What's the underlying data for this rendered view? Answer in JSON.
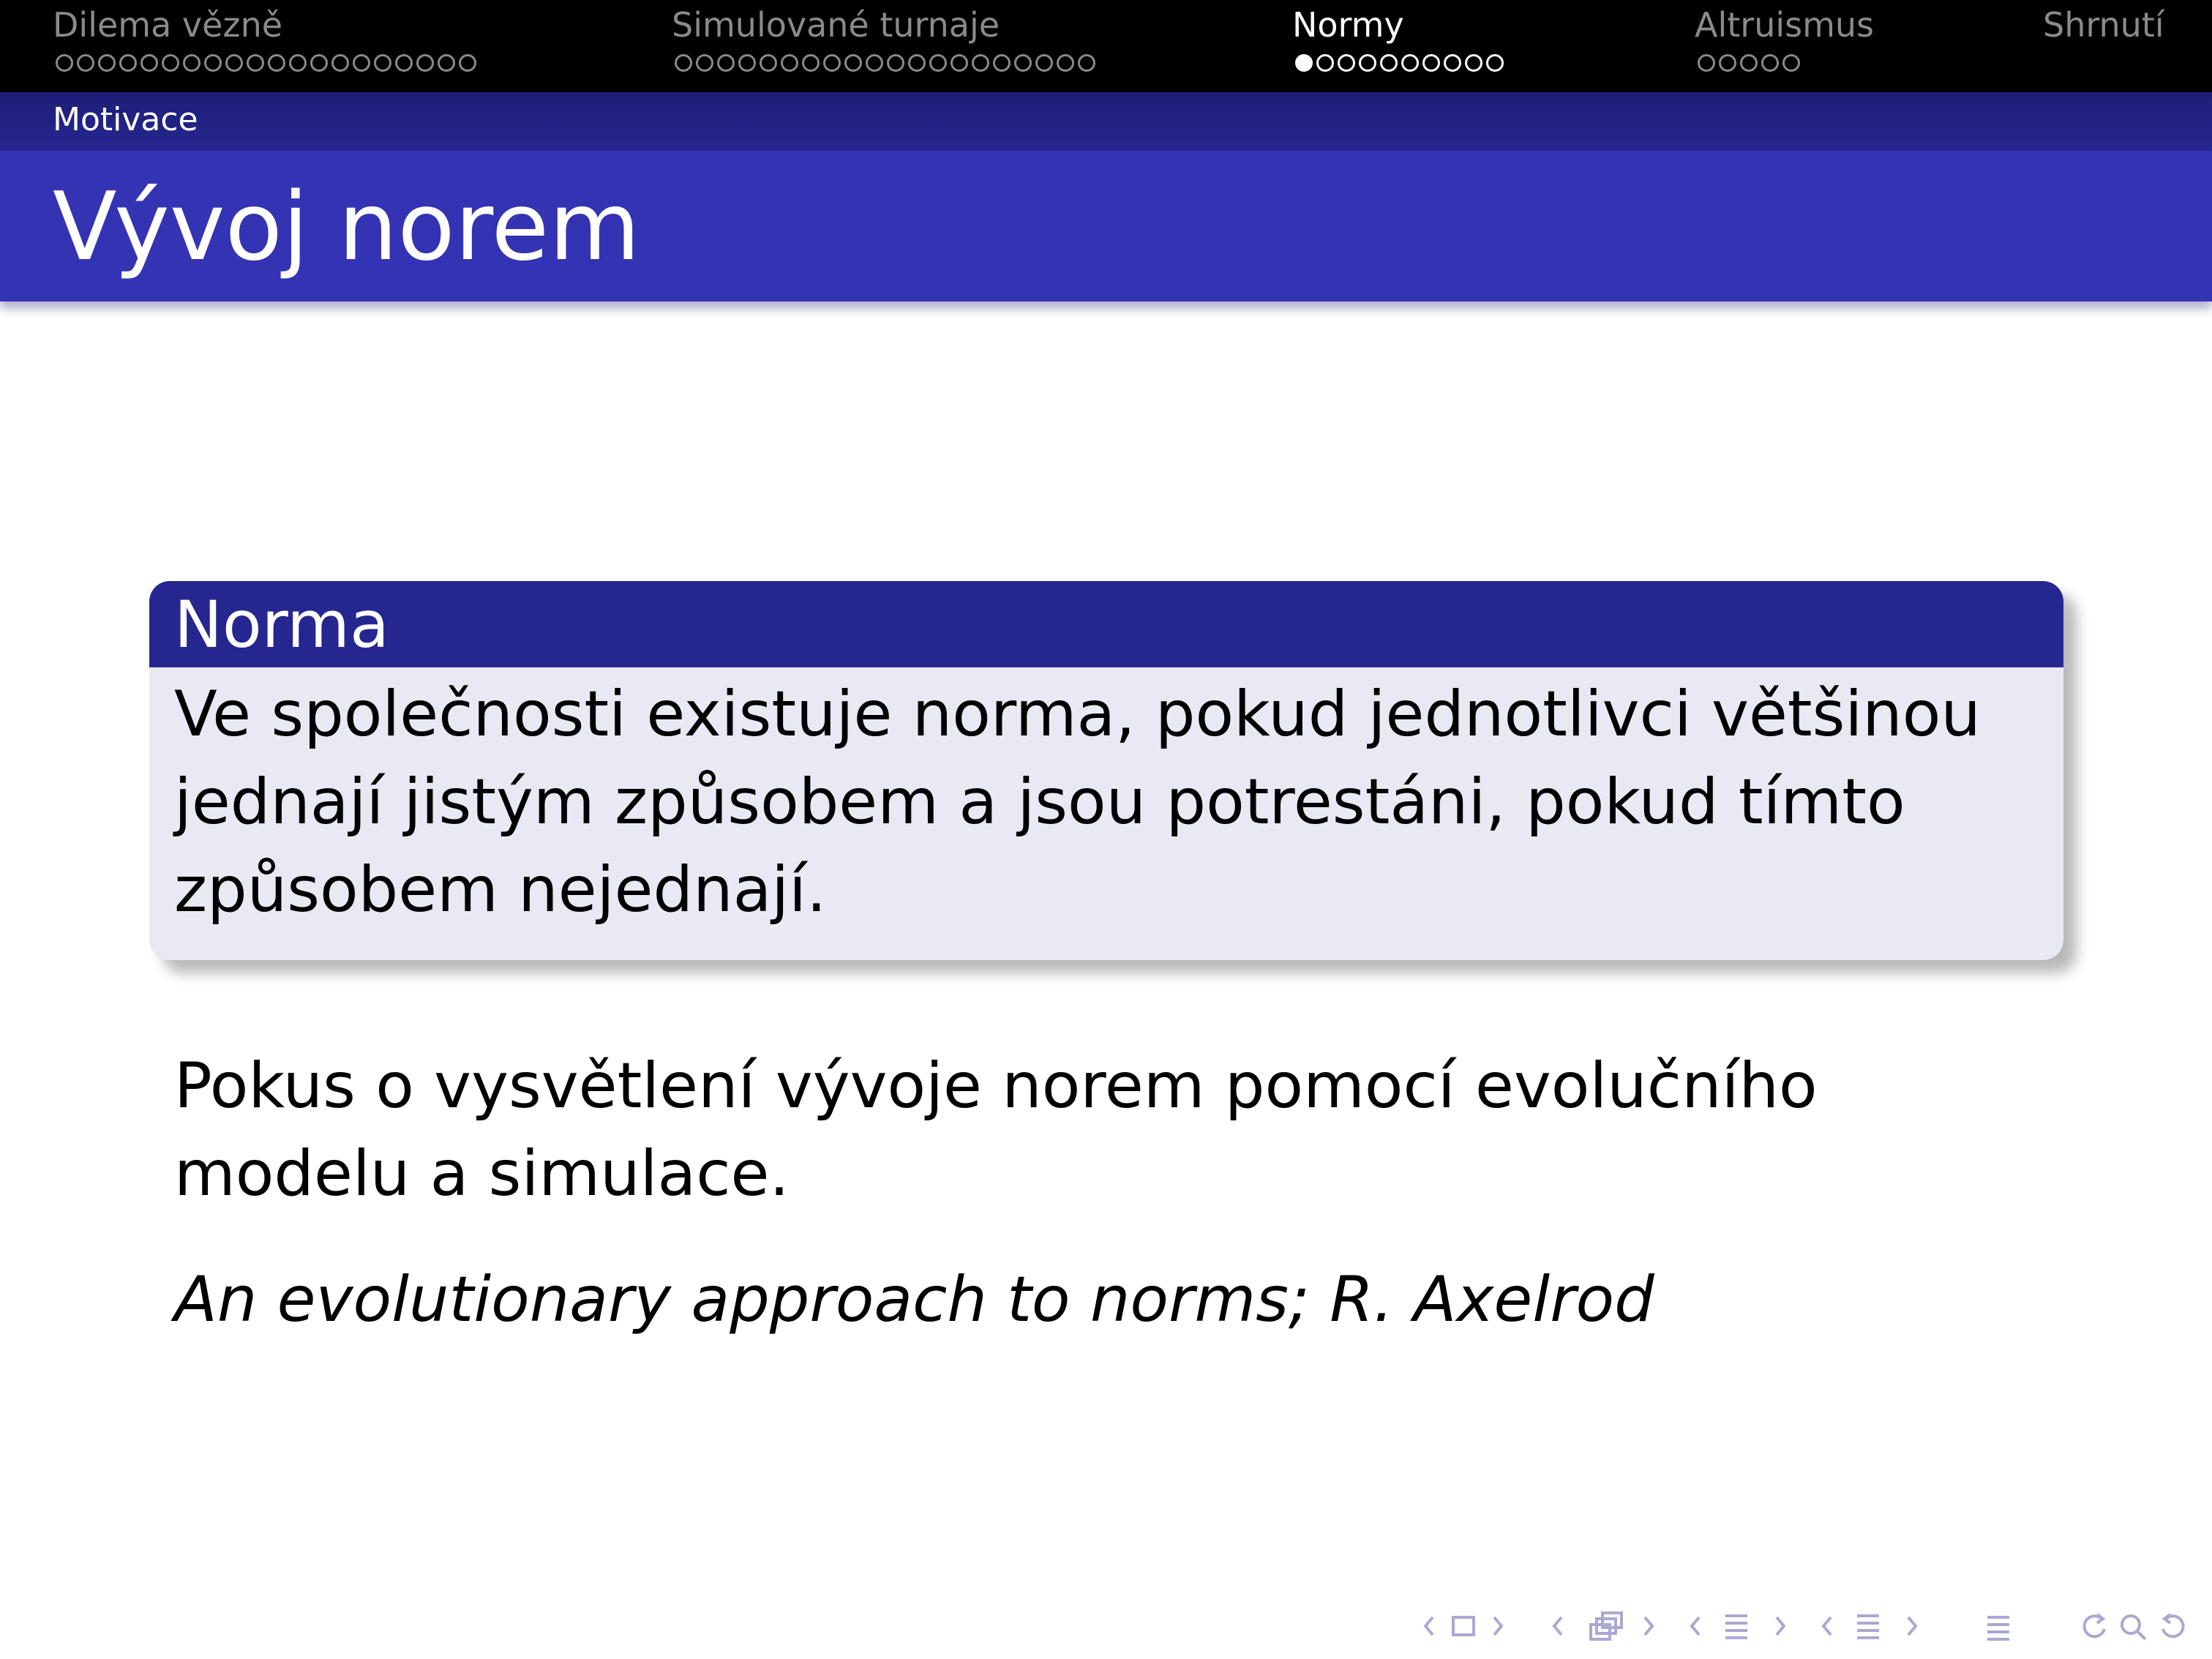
{
  "navigation": {
    "sections": [
      {
        "label": "Dilema vězně",
        "dots": 20,
        "active": false,
        "current_dot": -1
      },
      {
        "label": "Simulované turnaje",
        "dots": 20,
        "active": false,
        "current_dot": -1
      },
      {
        "label": "Normy",
        "dots": 10,
        "active": true,
        "current_dot": 0
      },
      {
        "label": "Altruismus",
        "dots": 5,
        "active": false,
        "current_dot": -1
      },
      {
        "label": "Shrnutí",
        "dots": 0,
        "active": false,
        "current_dot": -1
      }
    ]
  },
  "subsection": "Motivace",
  "frame_title": "Vývoj norem",
  "definition_block": {
    "title": "Norma",
    "body": "Ve společnosti existuje norma, pokud jednotlivci většinou jednají jistým způsobem a jsou potrestáni, pokud tímto způsobem nejednají."
  },
  "paragraph": "Pokus o vysvětlení vývoje norem pomocí evolučního modelu a simulace.",
  "citation": "An evolutionary approach to norms; R. Axelrod",
  "nav_symbols": [
    "frame-nav-icon",
    "subsection-nav-icon",
    "section-nav-icon",
    "presentation-nav-icon",
    "appendix-icon",
    "search-zoom-icon"
  ],
  "colors": {
    "nav_bar": "#000000",
    "nav_inactive": "#8a8a8a",
    "nav_active": "#ffffff",
    "subsection_bar": "#26268f",
    "title_bar": "#3333b3",
    "block_header": "#262690",
    "block_body": "#e9e9f3",
    "nav_symbols": "#a9a9d3"
  }
}
